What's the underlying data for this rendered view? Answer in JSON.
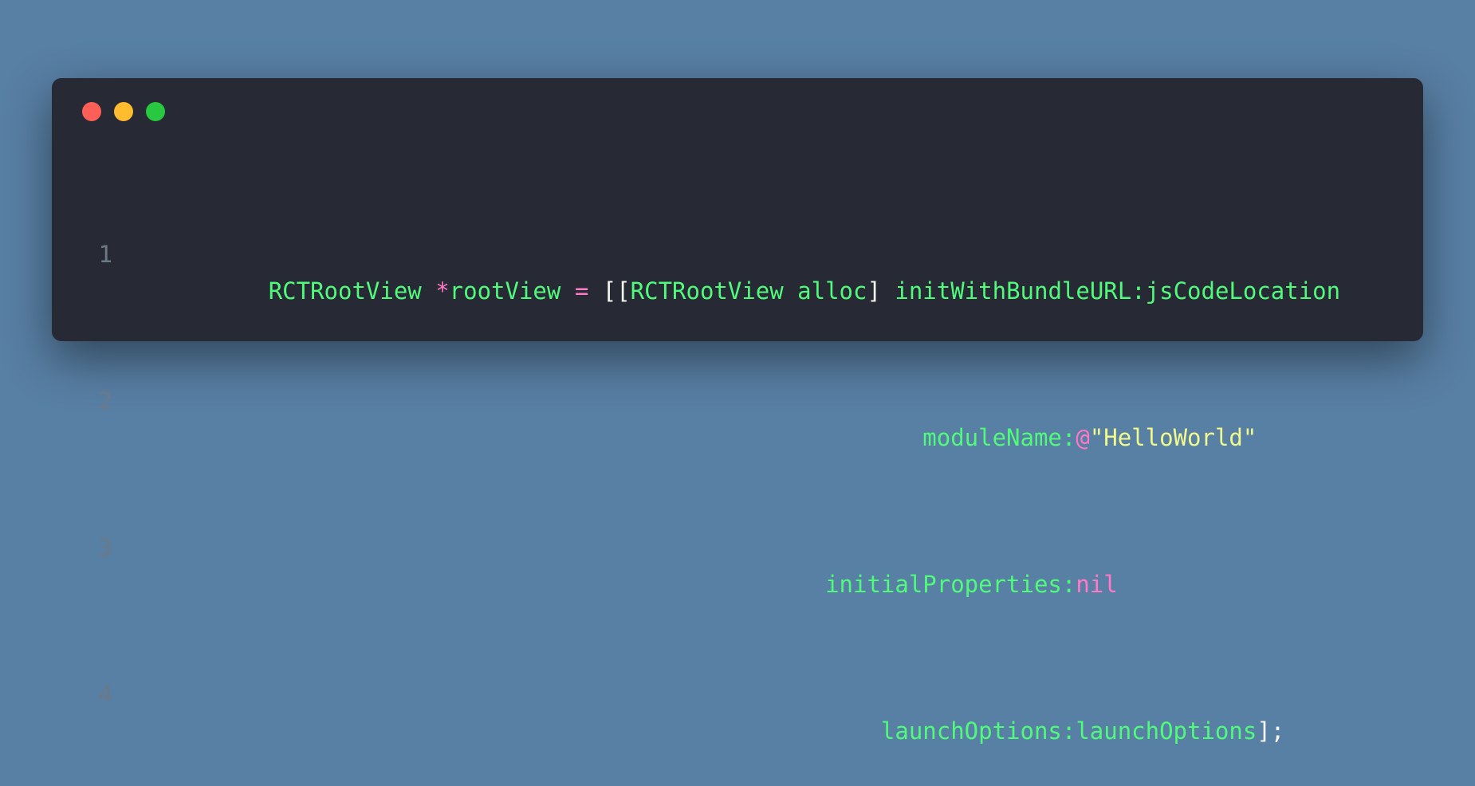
{
  "window": {
    "controls": [
      "close",
      "minimize",
      "zoom"
    ],
    "colors": {
      "background_page": "#587fa4",
      "background_editor": "#272935",
      "close": "#ff5f57",
      "minimize": "#febc2e",
      "zoom": "#28c840",
      "line_number": "#6c7986",
      "identifier": "#50fa7b",
      "keyword": "#ff79c6",
      "string": "#f1fa8c",
      "punctuation": "#f8f8f2"
    }
  },
  "code": {
    "line_numbers": [
      "1",
      "2",
      "3",
      "4"
    ],
    "lines": [
      {
        "tokens": [
          {
            "text": "RCTRootView ",
            "class": "tok-green"
          },
          {
            "text": "*",
            "class": "tok-pink"
          },
          {
            "text": "rootView ",
            "class": "tok-green"
          },
          {
            "text": "= ",
            "class": "tok-pink"
          },
          {
            "text": "[[",
            "class": "tok-white"
          },
          {
            "text": "RCTRootView alloc",
            "class": "tok-green"
          },
          {
            "text": "] ",
            "class": "tok-white"
          },
          {
            "text": "initWithBundleURL:jsCodeLocation",
            "class": "tok-green"
          }
        ]
      },
      {
        "tokens": [
          {
            "text": "                                               moduleName:",
            "class": "tok-green"
          },
          {
            "text": "@",
            "class": "tok-pink"
          },
          {
            "text": "\"HelloWorld\"",
            "class": "tok-yellow"
          }
        ]
      },
      {
        "tokens": [
          {
            "text": "                                        initialProperties:",
            "class": "tok-green"
          },
          {
            "text": "nil",
            "class": "tok-pink"
          }
        ]
      },
      {
        "tokens": [
          {
            "text": "                                            launchOptions:launchOptions",
            "class": "tok-green"
          },
          {
            "text": "];",
            "class": "tok-white"
          }
        ]
      }
    ]
  }
}
